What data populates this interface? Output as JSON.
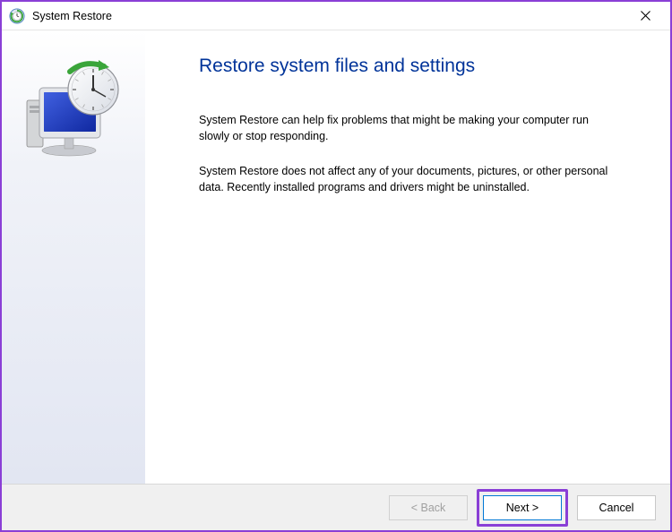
{
  "window": {
    "title": "System Restore"
  },
  "main": {
    "heading": "Restore system files and settings",
    "para1": "System Restore can help fix problems that might be making your computer run slowly or stop responding.",
    "para2": "System Restore does not affect any of your documents, pictures, or other personal data. Recently installed programs and drivers might be uninstalled."
  },
  "footer": {
    "back": "< Back",
    "next": "Next >",
    "cancel": "Cancel"
  }
}
